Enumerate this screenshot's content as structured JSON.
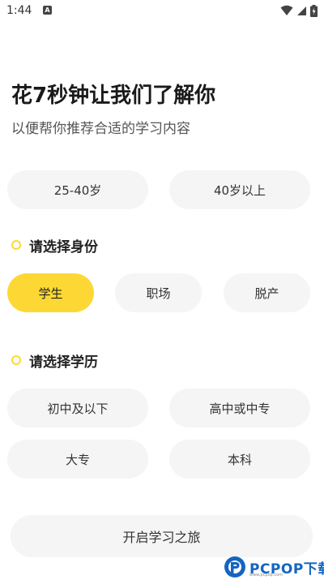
{
  "status_bar": {
    "time": "1:44",
    "notification_icon": "a-letter-icon",
    "icons": [
      "wifi-icon",
      "signal-icon",
      "battery-charging-icon"
    ]
  },
  "header": {
    "title": "花7秒钟让我们了解你",
    "subtitle": "以便帮你推荐合适的学习内容"
  },
  "age_options": {
    "items": [
      {
        "label": "25-40岁",
        "selected": false
      },
      {
        "label": "40岁以上",
        "selected": false
      }
    ]
  },
  "identity_section": {
    "label": "请选择身份",
    "items": [
      {
        "label": "学生",
        "selected": true
      },
      {
        "label": "职场",
        "selected": false
      },
      {
        "label": "脱产",
        "selected": false
      }
    ]
  },
  "education_section": {
    "label": "请选择学历",
    "items": [
      {
        "label": "初中及以下",
        "selected": false
      },
      {
        "label": "高中或中专",
        "selected": false
      },
      {
        "label": "大专",
        "selected": false
      },
      {
        "label": "本科",
        "selected": false
      }
    ]
  },
  "start_button": {
    "label": "开启学习之旅"
  },
  "watermark": {
    "text": "PCPOP下载",
    "subtext": "www.pcpop.com"
  },
  "colors": {
    "accent": "#fdd835",
    "chip_bg": "#f5f5f5",
    "title": "#1a1a1a",
    "subtitle": "#555555",
    "watermark": "#1565c0"
  }
}
